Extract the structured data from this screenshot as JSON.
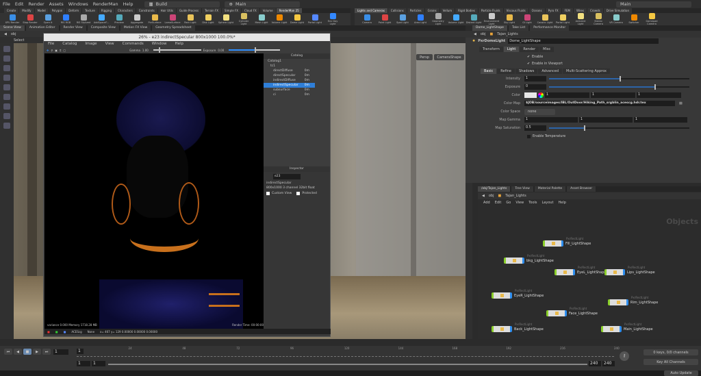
{
  "menubar": {
    "items": [
      "File",
      "Edit",
      "Render",
      "Assets",
      "Windows",
      "RenderMan",
      "Help"
    ],
    "desktop": "Build",
    "context": "Main",
    "right_context": "Main"
  },
  "shelf_left": {
    "tabs": [
      "Create",
      "Modify",
      "Model",
      "Polygon",
      "Deform",
      "Texture",
      "Rigging",
      "Characters",
      "Constraints",
      "Hair Utils",
      "Guide Process",
      "Terrain FX",
      "Simple FX",
      "Cloud FX",
      "Volume",
      "RenderMan 25"
    ],
    "active": "RenderMan 25",
    "tools": [
      "XPU Render",
      "Stop Render",
      "Open It",
      "RIS RGB",
      "RIS Stylized",
      "AddSpaceF...",
      "Preview",
      "Aggregate",
      "PxrSurface",
      "LamaSurface",
      "Rect Light",
      "Disk Light",
      "Sphere Light",
      "Cylinder Light",
      "Mesh Light",
      "Volume Light",
      "Dome Light",
      "Portal Light",
      "Env Day Light"
    ]
  },
  "shelf_right": {
    "tabs": [
      "Lights and Cameras",
      "Collisions",
      "Particles",
      "Grains",
      "Vellum",
      "Rigid Bodies",
      "Particle Fluids",
      "Viscous Fluids",
      "Oceans",
      "Pyro FX",
      "FEM",
      "Wires",
      "Crowds",
      "Drive Simulation"
    ],
    "active": "Lights and Cameras",
    "tools": [
      "Camera",
      "Point Light",
      "Spot Light",
      "Area Light",
      "Geometry Light",
      "Volume Light",
      "Distant Light",
      "Environment Light",
      "Sky Light",
      "GI Light",
      "Caustic Light",
      "Portal Light",
      "Ambient Light",
      "Stereo Camera",
      "VR Camera",
      "Switcher",
      "Gamepad Camera"
    ]
  },
  "left_panetabs": [
    "Scene View",
    "Animation Editor",
    "Render View",
    "Composite View",
    "Motion FX View",
    "Geometry Spreadsheet"
  ],
  "right_panetabs": [
    "Dome_LightShape",
    "Take List",
    "Performance Monitor"
  ],
  "viewport": {
    "path_root": "obj",
    "select_label": "Select",
    "persp": "Persp",
    "camera": "CameraShape"
  },
  "render_window": {
    "title": "26% - e23 indirectSpecular 800x1000 100.0%*",
    "menu": [
      "File",
      "Catalog",
      "Image",
      "View",
      "Commands",
      "Window",
      "Help"
    ],
    "gamma_label": "Gamma",
    "gamma": "1.00",
    "exposure_label": "Exposure",
    "exposure": "0.00",
    "catalog_title": "Catalog",
    "catalog_root": "Catalog1",
    "catalog_group": "tc1",
    "catalog_items": [
      {
        "name": "directDiffuse",
        "t": "0m"
      },
      {
        "name": "directSpecular",
        "t": "0m"
      },
      {
        "name": "indirectDiffuse",
        "t": "0m"
      },
      {
        "name": "indirectSpecular",
        "t": "0m"
      },
      {
        "name": "subsurface",
        "t": "0m"
      },
      {
        "name": "ci",
        "t": "0m"
      }
    ],
    "selected": "indirectSpecular",
    "inspector_title": "Inspector",
    "inspector_id": "e23",
    "inspector_name": "indirectSpecular",
    "inspector_info": "800x1000 3 channel 32bit float",
    "custom_view": "Custom View",
    "protected": "Protected",
    "status_left": "variance 0.000  Memory 1718.28 MB",
    "render_time": "Render Time: 00:00:00",
    "pixel_readout": "x= 467  y= 129  0.00000 0.00000 0.00000",
    "display": "ACEScg",
    "transform": "None"
  },
  "params": {
    "path_root": "obj",
    "path_node": "Tajan_Lights",
    "node_type": "PxrDomeLight",
    "node_name": "Dome_LightShape",
    "tabs": [
      "Transform",
      "Light",
      "Render",
      "Misc"
    ],
    "active_tab": "Light",
    "enable": "Enable",
    "enable_viewport": "Enable in Viewport",
    "subtabs": [
      "Basic",
      "Refine",
      "Shadows",
      "Advanced",
      "Multi-Scattering Approx"
    ],
    "active_subtab": "Basic",
    "intensity_label": "Intensity",
    "intensity": "1",
    "intensity_level": 0.5,
    "exposure_label": "Exposure",
    "exposure": "0",
    "exposure_level": 0.75,
    "color_label": "Color",
    "color": [
      "1",
      "1",
      "1"
    ],
    "colormap_label": "Color Map",
    "colormap": "$JOB/sourceimages/IBL/OutDoor/Hiking_Path_srgblin_acescg.hdr.tex",
    "colorspace_label": "Color Space",
    "colorspace": "none",
    "mapgamma_label": "Map Gamma",
    "mapgamma": [
      "1",
      "1",
      "1"
    ],
    "mapsat_label": "Map Saturation",
    "mapsat": "0.5",
    "mapsat_level": 0.25,
    "enable_temp": "Enable Temperature"
  },
  "network": {
    "tabs": [
      "/obj/Tajan_Lights",
      "Tree View",
      "Material Palette",
      "Asset Browser"
    ],
    "path_root": "obj",
    "path_node": "Tajan_Lights",
    "menu": [
      "Add",
      "Edit",
      "Go",
      "View",
      "Tools",
      "Layout",
      "Help"
    ],
    "context_label": "Objects",
    "nodes": [
      {
        "type": "PxrRectLight",
        "name": "Fill_LightShape"
      },
      {
        "type": "PxrRectLight",
        "name": "bkg_LightShape"
      },
      {
        "type": "PxrRectLight",
        "name": "EyeL_LightShape"
      },
      {
        "type": "PxrRectLight",
        "name": "Lips_LightShape"
      },
      {
        "type": "PxrRectLight",
        "name": "EyeR_LightShape"
      },
      {
        "type": "PxrRectLight",
        "name": "Rim_LightShape"
      },
      {
        "type": "PxrRectLight",
        "name": "Face_LightShape"
      },
      {
        "type": "PxrRectLight",
        "name": "Back_LightShape"
      },
      {
        "type": "PxrRectLight",
        "name": "Main_LightShape"
      }
    ]
  },
  "timeline": {
    "current_frame": "1",
    "ticks": [
      "24",
      "48",
      "72",
      "96",
      "120",
      "144",
      "168",
      "192",
      "216",
      "240"
    ],
    "start": "1",
    "start2": "1",
    "end": "240",
    "end2": "240",
    "keys": "0 keys, 0/0 channels",
    "key_all": "Key All Channels",
    "auto_update": "Auto Update"
  }
}
